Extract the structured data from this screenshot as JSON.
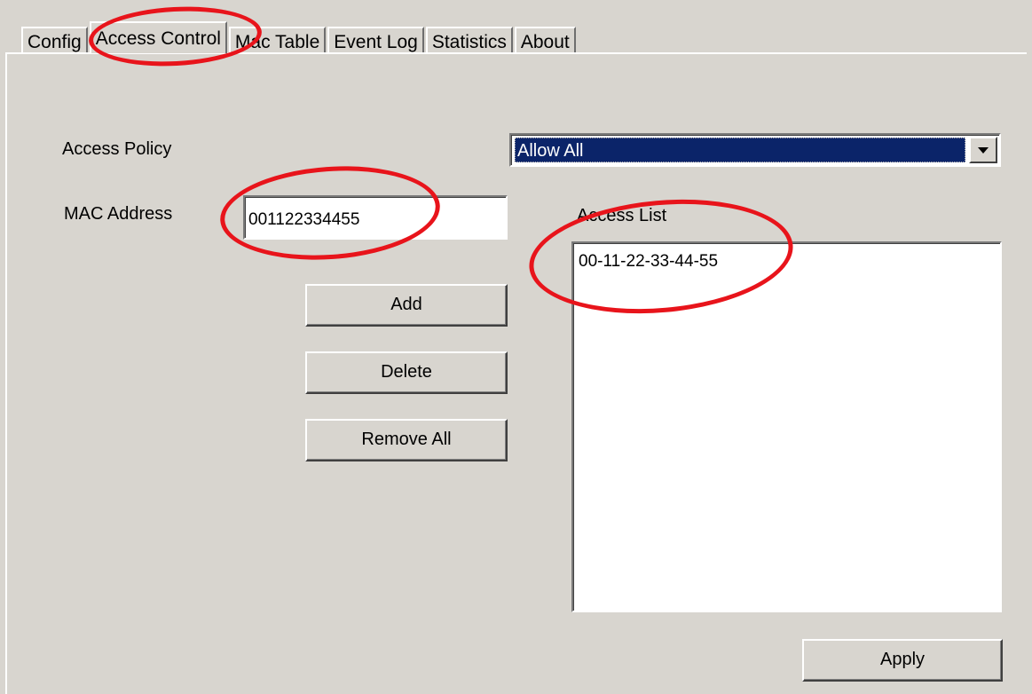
{
  "tabs": [
    {
      "label": "Config",
      "active": false
    },
    {
      "label": "Access Control",
      "active": true
    },
    {
      "label": "Mac Table",
      "active": false
    },
    {
      "label": "Event Log",
      "active": false
    },
    {
      "label": "Statistics",
      "active": false
    },
    {
      "label": "About",
      "active": false
    }
  ],
  "access_policy": {
    "label": "Access Policy",
    "selected": "Allow All"
  },
  "mac_address": {
    "label": "MAC Address",
    "value": "001122334455"
  },
  "access_list": {
    "label": "Access List",
    "items": [
      "00-11-22-33-44-55"
    ]
  },
  "buttons": {
    "add": "Add",
    "delete": "Delete",
    "remove_all": "Remove All",
    "apply": "Apply"
  },
  "colors": {
    "annotation": "#e8141b",
    "selection": "#0b2469",
    "background": "#d8d5cf"
  }
}
